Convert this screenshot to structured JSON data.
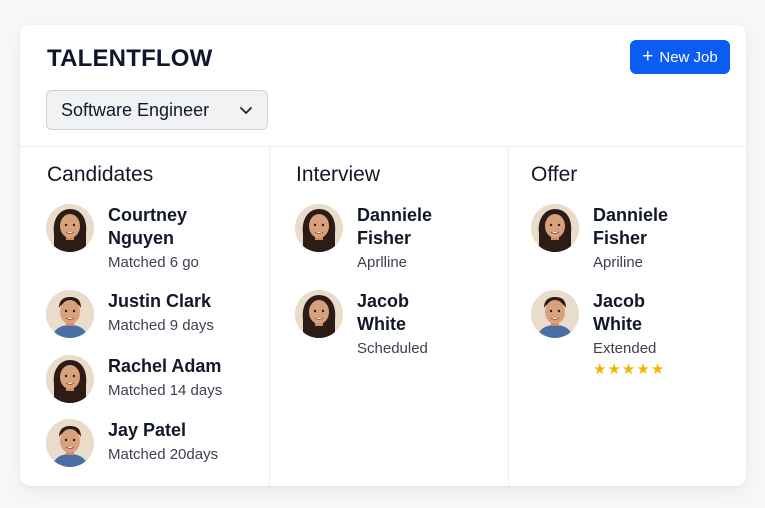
{
  "header": {
    "logo": "TALENTFLOW",
    "new_job_label": "New Job",
    "job_select_value": "Software Engineer"
  },
  "columns": [
    {
      "title": "Candidates",
      "items": [
        {
          "name_line1": "Courtney",
          "name_line2": "Nguyen",
          "status": "Matched  6 go"
        },
        {
          "name_line1": "Justin Clark",
          "name_line2": "",
          "status": "Matched  9 days"
        },
        {
          "name_line1": "Rachel Adam",
          "name_line2": "",
          "status": "Matched 14 days"
        },
        {
          "name_line1": "Jay Patel",
          "name_line2": "",
          "status": "Matched 20days"
        }
      ]
    },
    {
      "title": "Interview",
      "items": [
        {
          "name_line1": "Danniele",
          "name_line2": "Fisher",
          "status": "Aprlline"
        },
        {
          "name_line1": "Jacob",
          "name_line2": "White",
          "status": "Scheduled"
        }
      ]
    },
    {
      "title": "Offer",
      "items": [
        {
          "name_line1": "Danniele",
          "name_line2": "Fisher",
          "status": "Apriline"
        },
        {
          "name_line1": "Jacob",
          "name_line2": "White",
          "status": "Extended",
          "rating": 5,
          "rating_max": 5
        }
      ]
    }
  ],
  "colors": {
    "accent": "#0b5cf2",
    "star": "#f5b301"
  },
  "icons": [
    "plus-icon",
    "chevron-down-icon",
    "star-icon"
  ]
}
